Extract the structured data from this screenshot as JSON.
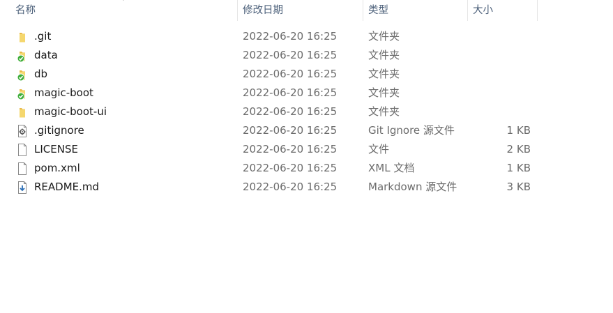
{
  "columns": {
    "name": "名称",
    "date": "修改日期",
    "type": "类型",
    "size": "大小"
  },
  "files": [
    {
      "name": ".git",
      "date": "2022-06-20 16:25",
      "type": "文件夹",
      "size": "",
      "icon": "folder-icon"
    },
    {
      "name": "data",
      "date": "2022-06-20 16:25",
      "type": "文件夹",
      "size": "",
      "icon": "folder-synced-icon"
    },
    {
      "name": "db",
      "date": "2022-06-20 16:25",
      "type": "文件夹",
      "size": "",
      "icon": "folder-synced-icon"
    },
    {
      "name": "magic-boot",
      "date": "2022-06-20 16:25",
      "type": "文件夹",
      "size": "",
      "icon": "folder-synced-icon"
    },
    {
      "name": "magic-boot-ui",
      "date": "2022-06-20 16:25",
      "type": "文件夹",
      "size": "",
      "icon": "folder-icon"
    },
    {
      "name": ".gitignore",
      "date": "2022-06-20 16:25",
      "type": "Git Ignore 源文件",
      "size": "1 KB",
      "icon": "settings-file-icon"
    },
    {
      "name": "LICENSE",
      "date": "2022-06-20 16:25",
      "type": "文件",
      "size": "2 KB",
      "icon": "file-icon"
    },
    {
      "name": "pom.xml",
      "date": "2022-06-20 16:25",
      "type": "XML 文档",
      "size": "1 KB",
      "icon": "file-icon"
    },
    {
      "name": "README.md",
      "date": "2022-06-20 16:25",
      "type": "Markdown 源文件",
      "size": "3 KB",
      "icon": "markdown-file-icon"
    }
  ],
  "colors": {
    "header_text": "#4c607a",
    "folder": "#f5d76e",
    "sync_badge": "#3fae3a",
    "secondary_text": "#6b6b6b"
  }
}
